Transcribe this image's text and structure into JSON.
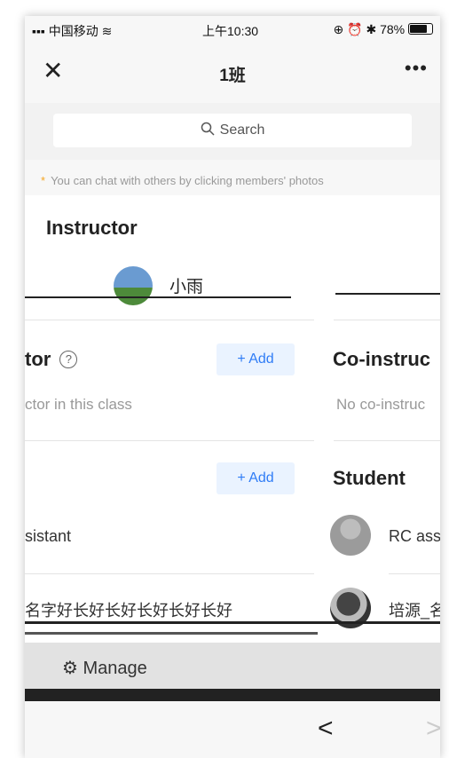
{
  "status_bar": {
    "carrier": "中国移动",
    "time": "上午10:30",
    "battery": "78%"
  },
  "header": {
    "title": "1班",
    "close_symbol": "✕",
    "more_symbol": "•••"
  },
  "search": {
    "placeholder": "Search"
  },
  "hint": "You can chat with others by clicking members' photos",
  "instructor": {
    "heading": "Instructor",
    "name": "小雨"
  },
  "left_column": {
    "heading": "tor",
    "add_label": "+ Add",
    "empty_text": "ctor in this class",
    "add_label_2": "+ Add",
    "assistant_text": "sistant",
    "long_name": "名字好长好长好长好长好长好"
  },
  "right_column": {
    "coinstructor_heading": "Co-instruc",
    "coinstructor_empty": "No co-instruc",
    "student_heading": "Student",
    "student_1": "RC ass",
    "student_2": "培源_名"
  },
  "bottom": {
    "manage_label": "Manage",
    "back": "<",
    "forward": ">"
  },
  "icons": {
    "wifi": "wifi-icon",
    "settings": "gear-icon",
    "search": "search-icon",
    "help": "help-icon"
  },
  "colors": {
    "accent": "#2f7cf6",
    "add_bg": "#eaf3ff",
    "hint_star": "#f5a623"
  }
}
